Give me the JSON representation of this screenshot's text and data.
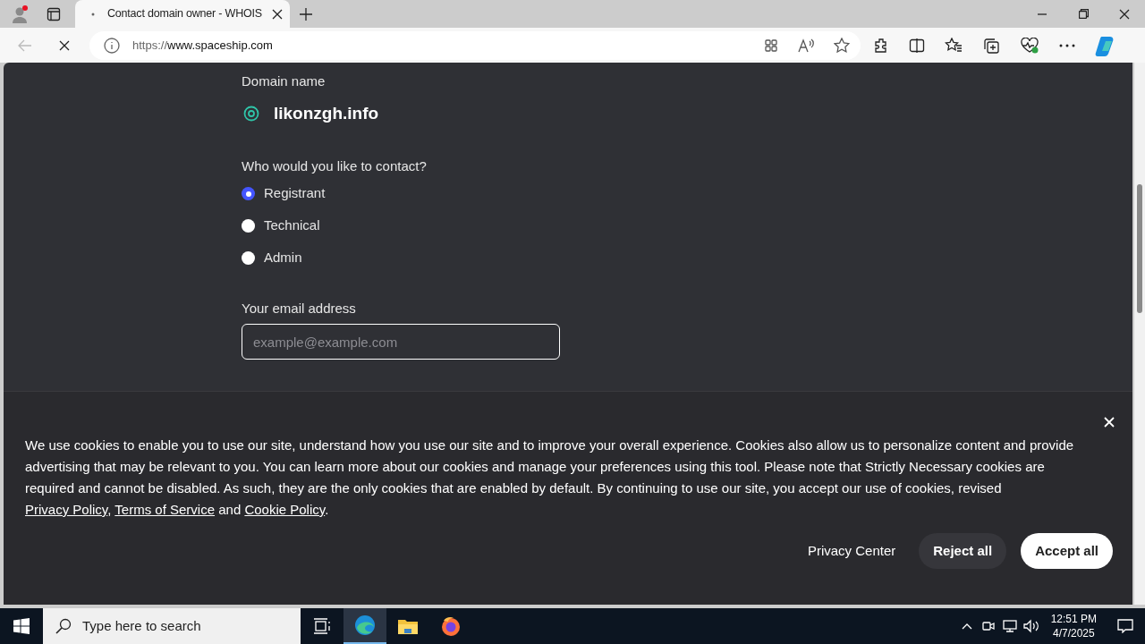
{
  "browser": {
    "tab_title": "Contact domain owner - WHOIS",
    "url_scheme": "https://",
    "url_host": "www.spaceship.com"
  },
  "page": {
    "domain_label": "Domain name",
    "domain": "likonzgh.info",
    "question": "Who would you like to contact?",
    "contacts": [
      {
        "label": "Registrant",
        "selected": true
      },
      {
        "label": "Technical",
        "selected": false
      },
      {
        "label": "Admin",
        "selected": false
      }
    ],
    "email_label": "Your email address",
    "email_placeholder": "example@example.com"
  },
  "cookie_banner": {
    "parts": [
      {
        "kind": "text",
        "text": "We use cookies to enable you to use our site, understand how you use our site and to improve your overall experience. Cookies also allow us to personalize content and provide advertising that may be relevant to you. You can learn more about our cookies and manage your preferences using this tool. Please note that Strictly Necessary cookies are required and cannot be disabled. As such, they are the only cookies that are enabled by default. By continuing to use our site, you accept our use of cookies, revised "
      },
      {
        "kind": "link",
        "text": "Privacy Policy"
      },
      {
        "kind": "text",
        "text": ", "
      },
      {
        "kind": "link",
        "text": "Terms of Service"
      },
      {
        "kind": "text",
        "text": " and "
      },
      {
        "kind": "link",
        "text": "Cookie Policy"
      },
      {
        "kind": "text",
        "text": "."
      }
    ],
    "buttons": [
      {
        "label": "Privacy Center",
        "kind": "plain"
      },
      {
        "label": "Reject all",
        "kind": "secondary"
      },
      {
        "label": "Accept all",
        "kind": "primary"
      }
    ]
  },
  "taskbar": {
    "search_placeholder": "Type here to search",
    "time": "12:51 PM",
    "date": "4/7/2025"
  }
}
